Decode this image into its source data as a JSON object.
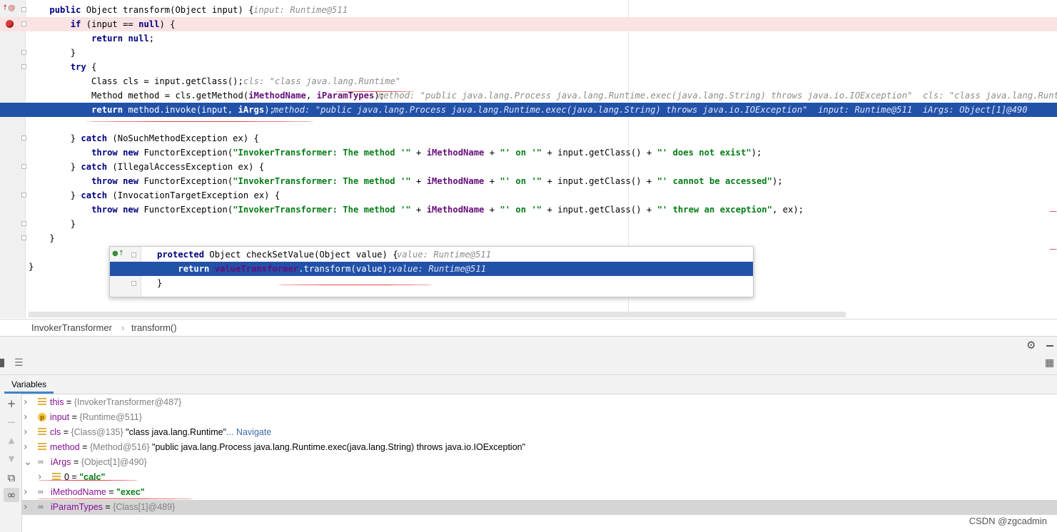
{
  "editor": {
    "lines": [
      {
        "t": "    public Object transform(Object input) {",
        "hint": "input: Runtime@511"
      },
      {
        "t": "        if (input == null) {"
      },
      {
        "t": "            return null;"
      },
      {
        "t": "        }"
      },
      {
        "t": "        try {"
      },
      {
        "t": "            Class cls = input.getClass();",
        "hint": "cls: \"class java.lang.Runtime\""
      },
      {
        "t": "            Method method = cls.getMethod(iMethodName, iParamTypes);",
        "hint": "method: \"public java.lang.Process java.lang.Runtime.exec(java.lang.String) throws java.io.IOException\"  cls: \"class java.lang.Runtime\""
      },
      {
        "t": "            return method.invoke(input, iArgs);",
        "hint": "method: \"public java.lang.Process java.lang.Runtime.exec(java.lang.String) throws java.io.IOException\"  input: Runtime@511  iArgs: Object[1]@490"
      },
      {
        "t": ""
      },
      {
        "t": "        } catch (NoSuchMethodException ex) {"
      },
      {
        "t": "            throw new FunctorException(\"InvokerTransformer: The method '\" + iMethodName + \"' on '\" + input.getClass() + \"' does not exist\");"
      },
      {
        "t": "        } catch (IllegalAccessException ex) {"
      },
      {
        "t": "            throw new FunctorException(\"InvokerTransformer: The method '\" + iMethodName + \"' on '\" + input.getClass() + \"' cannot be accessed\");"
      },
      {
        "t": "        } catch (InvocationTargetException ex) {"
      },
      {
        "t": "            throw new FunctorException(\"InvokerTransformer: The method '\" + iMethodName + \"' on '\" + input.getClass() + \"' threw an exception\", ex);"
      },
      {
        "t": "        }"
      },
      {
        "t": "    }"
      },
      {
        "t": ""
      },
      {
        "t": "}"
      }
    ]
  },
  "popup": {
    "lines": [
      {
        "t": "protected Object checkSetValue(Object value) {",
        "hint": "value: Runtime@511"
      },
      {
        "t": "    return valueTransformer.transform(value);",
        "hint": "value: Runtime@511"
      },
      {
        "t": "}"
      }
    ]
  },
  "breadcrumb": {
    "class_name": "InvokerTransformer",
    "method_name": "transform()"
  },
  "variables_tab": {
    "label": "Variables"
  },
  "variables": [
    {
      "icon": "field-icon",
      "name": "this",
      "eq": " = ",
      "ref": "{InvokerTransformer@487}",
      "expanded": false
    },
    {
      "icon": "param-icon",
      "name": "input",
      "eq": " = ",
      "ref": "{Runtime@511}",
      "expanded": false
    },
    {
      "icon": "field-icon",
      "name": "cls",
      "eq": " = ",
      "ref": "{Class@135}",
      "value": " \"class java.lang.Runtime\"",
      "link": "... Navigate",
      "expanded": false
    },
    {
      "icon": "field-icon",
      "name": "method",
      "eq": " = ",
      "ref": "{Method@516}",
      "value": " \"public java.lang.Process java.lang.Runtime.exec(java.lang.String) throws java.io.IOException\"",
      "expanded": false
    },
    {
      "icon": "watch-icon",
      "name": "iArgs",
      "eq": " = ",
      "ref": "{Object[1]@490}",
      "expanded": true
    },
    {
      "icon": "field-icon",
      "name": "0",
      "eq": " = ",
      "str": "\"calc\"",
      "indent": true
    },
    {
      "icon": "watch-icon",
      "name": "iMethodName",
      "eq": " = ",
      "str": "\"exec\""
    },
    {
      "icon": "watch-icon",
      "name": "iParamTypes",
      "eq": " = ",
      "ref": "{Class[1]@489}",
      "selected": true
    }
  ],
  "watermark": "CSDN @zgcadmin",
  "colors": {
    "selection": "#2251a8",
    "breakpoint": "#d63c3c",
    "breakpoint_line": "#fae3e3",
    "keyword": "#000080",
    "string": "#067d17",
    "field": "#660e7a"
  },
  "icons": [
    "breakpoint-icon",
    "fold-icon",
    "override-icon",
    "bulb-icon",
    "gear-icon",
    "minimize-icon",
    "add-watch-icon",
    "expand-arrow-icon",
    "glasses-icon",
    "copy-icon",
    "layout-icon"
  ]
}
